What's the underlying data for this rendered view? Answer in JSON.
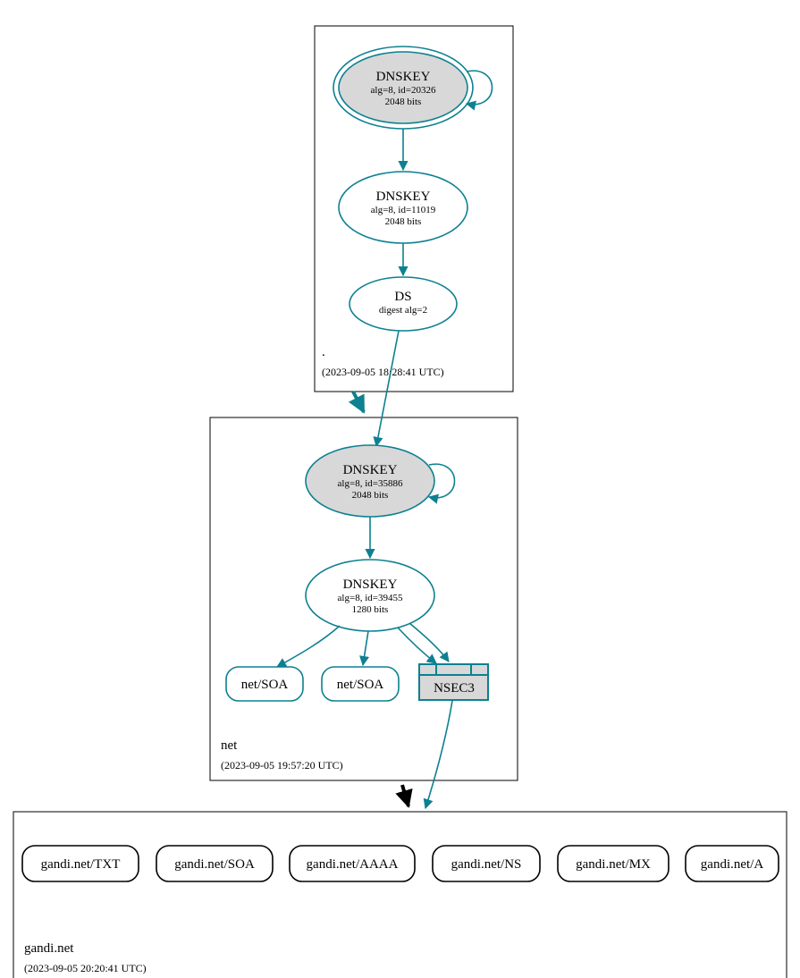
{
  "colors": {
    "accent": "#0d8091",
    "shade": "#d8d8d8"
  },
  "zones": {
    "root": {
      "label": ".",
      "timestamp": "(2023-09-05 18:28:41 UTC)",
      "nodes": {
        "ksk": {
          "title": "DNSKEY",
          "line1": "alg=8, id=20326",
          "line2": "2048 bits"
        },
        "zsk": {
          "title": "DNSKEY",
          "line1": "alg=8, id=11019",
          "line2": "2048 bits"
        },
        "ds": {
          "title": "DS",
          "line1": "digest alg=2"
        }
      }
    },
    "net": {
      "label": "net",
      "timestamp": "(2023-09-05 19:57:20 UTC)",
      "nodes": {
        "ksk": {
          "title": "DNSKEY",
          "line1": "alg=8, id=35886",
          "line2": "2048 bits"
        },
        "zsk": {
          "title": "DNSKEY",
          "line1": "alg=8, id=39455",
          "line2": "1280 bits"
        },
        "soa1": {
          "label": "net/SOA"
        },
        "soa2": {
          "label": "net/SOA"
        },
        "nsec3": {
          "label": "NSEC3"
        }
      }
    },
    "gandi": {
      "label": "gandi.net",
      "timestamp": "(2023-09-05 20:20:41 UTC)",
      "records": {
        "txt": "gandi.net/TXT",
        "soa": "gandi.net/SOA",
        "aaaa": "gandi.net/AAAA",
        "ns": "gandi.net/NS",
        "mx": "gandi.net/MX",
        "a": "gandi.net/A"
      }
    }
  }
}
